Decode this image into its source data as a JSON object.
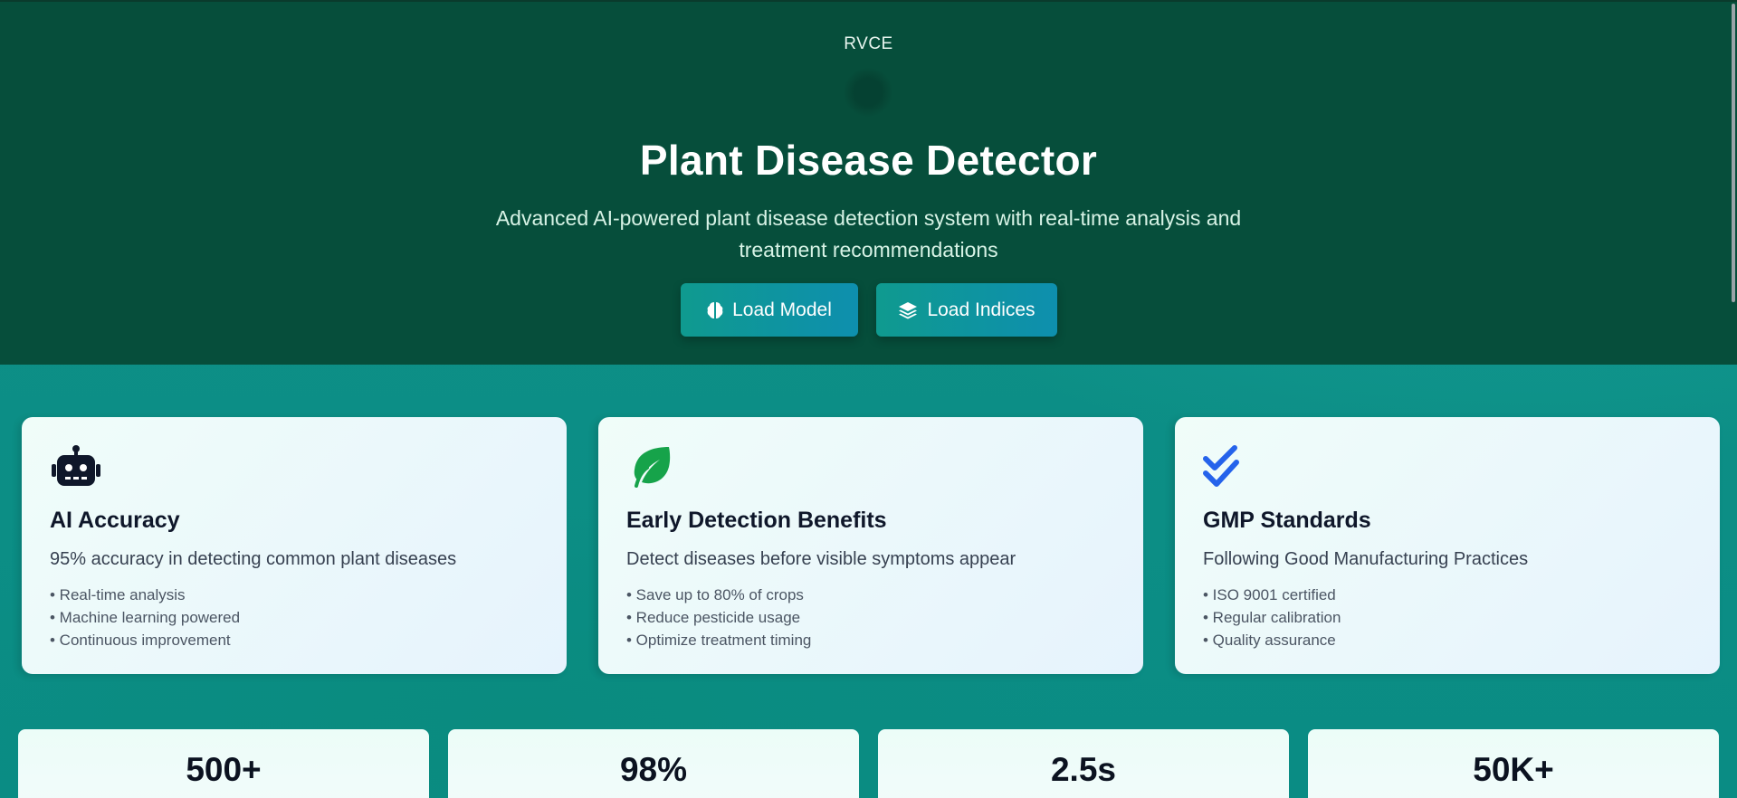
{
  "header": {
    "brand": "RVCE",
    "title": "Plant Disease Detector",
    "subtitle": "Advanced AI-powered plant disease detection system with real-time analysis and treatment recommendations"
  },
  "actions": {
    "load_model_label": "Load Model",
    "load_model_icon": "brain-icon",
    "load_indices_label": "Load Indices",
    "load_indices_icon": "layers-icon"
  },
  "features": [
    {
      "icon": "robot-icon",
      "icon_color": "#0f172a",
      "title": "AI Accuracy",
      "description": "95% accuracy in detecting common plant diseases",
      "bullets": [
        "• Real-time analysis",
        "• Machine learning powered",
        "• Continuous improvement"
      ]
    },
    {
      "icon": "leaf-icon",
      "icon_color": "#16a34a",
      "title": "Early Detection Benefits",
      "description": "Detect diseases before visible symptoms appear",
      "bullets": [
        "• Save up to 80% of crops",
        "• Reduce pesticide usage",
        "• Optimize treatment timing"
      ]
    },
    {
      "icon": "double-check-icon",
      "icon_color": "#2563eb",
      "title": "GMP Standards",
      "description": "Following Good Manufacturing Practices",
      "bullets": [
        "• ISO 9001 certified",
        "• Regular calibration",
        "• Quality assurance"
      ]
    }
  ],
  "stats": [
    {
      "value": "500+"
    },
    {
      "value": "98%"
    },
    {
      "value": "2.5s"
    },
    {
      "value": "50K+"
    }
  ],
  "colors": {
    "hero_bg": "#064e3b",
    "accent_button": "#0f9a8f",
    "page_bg": "#0d8f86"
  }
}
